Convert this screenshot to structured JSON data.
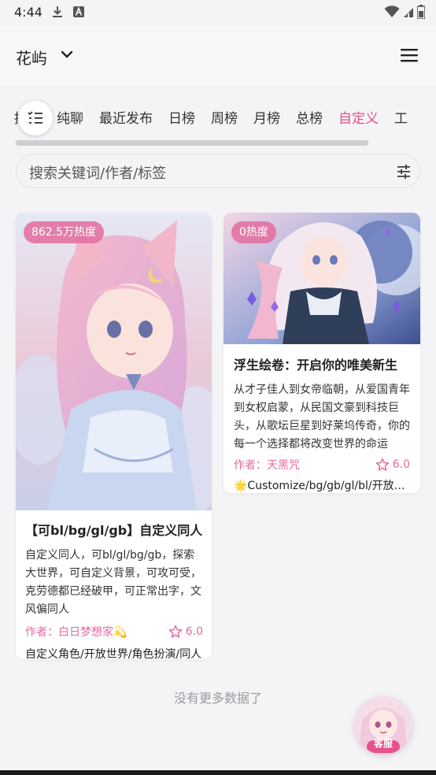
{
  "status_bar": {
    "time": "4:44",
    "icons": [
      "download-icon",
      "a-icon",
      "wifi-icon",
      "signal-icon",
      "battery-icon"
    ]
  },
  "app_bar": {
    "title": "花屿",
    "menu_icon": "hamburger-menu-icon"
  },
  "tabs": {
    "items": [
      "推荐",
      "纯聊",
      "最近发布",
      "日榜",
      "周榜",
      "月榜",
      "总榜",
      "自定义",
      "工"
    ],
    "active": "自定义",
    "accent": "#e84e8b"
  },
  "search": {
    "placeholder": "搜索关键词/作者/标签"
  },
  "cards": [
    {
      "heat": "862.5万热度",
      "title": "【可bl/bg/gl/gb】自定义同人",
      "desc": "自定义同人，可bl/gl/bg/gb，探索大世界，可自定义背景，可攻可受，克劳德都已经破甲，可正常出字，文风偏同人",
      "author": "作者：白日梦想家💫",
      "rating": "6.0",
      "tags": "自定义角色/开放世界/角色扮演/同人"
    },
    {
      "heat": "0热度",
      "title": "浮生绘卷：开启你的唯美新生",
      "desc": "从才子佳人到女帝临朝，从爱国青年到女权启蒙，从民国文豪到科技巨头，从歌坛巨星到好莱坞传奇，你的每一个选择都将改变世界的命运",
      "author": "作者：天黑咒",
      "rating": "6.0",
      "tags": "🌟Customize/bg/gb/gl/bl/开放世界"
    }
  ],
  "footer": {
    "no_more": "没有更多数据了",
    "service_label": "客服"
  }
}
